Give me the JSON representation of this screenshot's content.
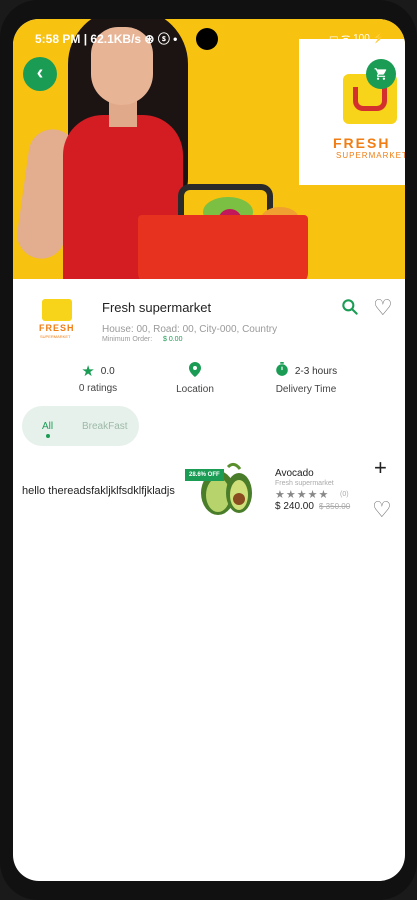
{
  "status_bar": {
    "time": "5:58 PM",
    "speed": "62.1KB/s",
    "battery": "100"
  },
  "store": {
    "name": "Fresh supermarket",
    "address": "House: 00, Road: 00, City-000, Country",
    "min_order_label": "Minimum Order:",
    "min_order_value": "$ 0.00",
    "logo_word": "FRESH",
    "logo_sub": "SUPERMARKET"
  },
  "stats": {
    "rating_value": "0.0",
    "rating_label": "0 ratings",
    "location_label": "Location",
    "delivery_value": "2-3 hours",
    "delivery_label": "Delivery Time"
  },
  "tabs": [
    {
      "label": "All"
    },
    {
      "label": "BreakFast"
    }
  ],
  "category_text": "hello thereadsfakljklfsdklfjkladjs",
  "product": {
    "discount": "28.6% OFF",
    "name": "Avocado",
    "store": "Fresh supermarket",
    "rating_count": "(0)",
    "price": "$ 240.00",
    "old_price": "$ 350.00",
    "stars": 0
  },
  "colors": {
    "accent": "#1a9c55",
    "hero_bg": "#f7c210",
    "logo_orange": "#f07e14"
  }
}
